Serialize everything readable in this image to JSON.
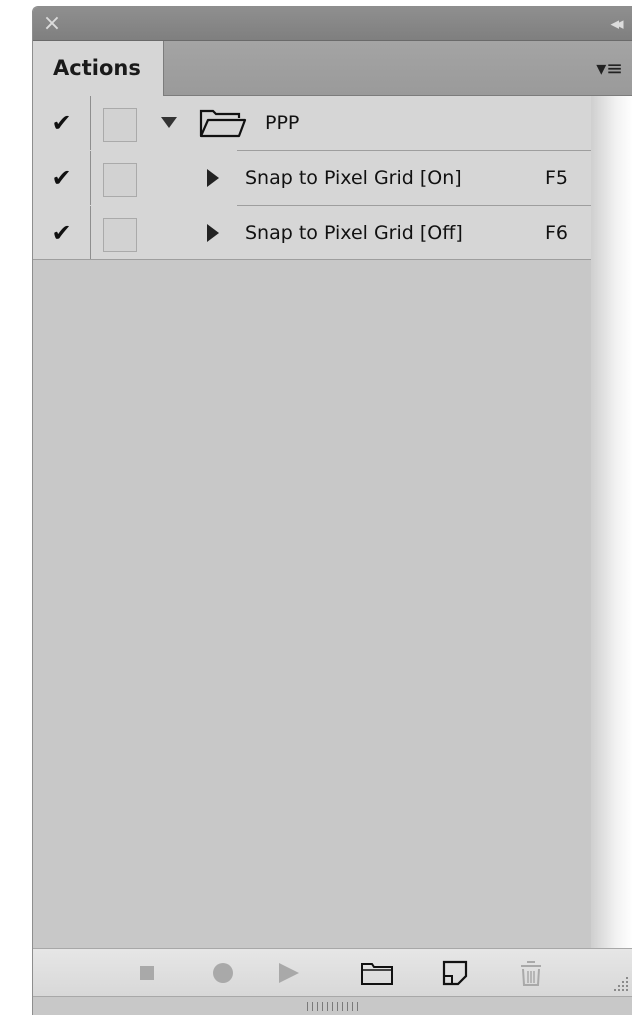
{
  "panel": {
    "close_glyph": "×",
    "collapse_glyph": "◂◂",
    "menu_glyph": "▾≡"
  },
  "tabs": [
    {
      "label": "Actions",
      "active": true
    }
  ],
  "actions": [
    {
      "enabled_glyph": "✔",
      "type": "set",
      "name": "PPP",
      "expanded": true,
      "shortcut": ""
    },
    {
      "enabled_glyph": "✔",
      "type": "action",
      "name": "Snap to Pixel Grid [On]",
      "expanded": false,
      "shortcut": "F5"
    },
    {
      "enabled_glyph": "✔",
      "type": "action",
      "name": "Snap to Pixel Grid [Off]",
      "expanded": false,
      "shortcut": "F6"
    }
  ],
  "toolbar": {
    "buttons": [
      {
        "name": "stop-playing-button",
        "icon": "stop-icon"
      },
      {
        "name": "begin-recording-button",
        "icon": "record-icon"
      },
      {
        "name": "play-selection-button",
        "icon": "play-icon"
      },
      {
        "name": "create-new-set-button",
        "icon": "folder-icon"
      },
      {
        "name": "create-new-action-button",
        "icon": "new-item-icon"
      },
      {
        "name": "delete-button",
        "icon": "trash-icon"
      }
    ]
  },
  "colors": {
    "panel_bg": "#c8c8c8",
    "titlebar_bg": "#858585",
    "tab_active_bg": "#d6d6d6",
    "list_bg": "#d6d6d6",
    "disabled_icon": "#a9a9a9"
  }
}
